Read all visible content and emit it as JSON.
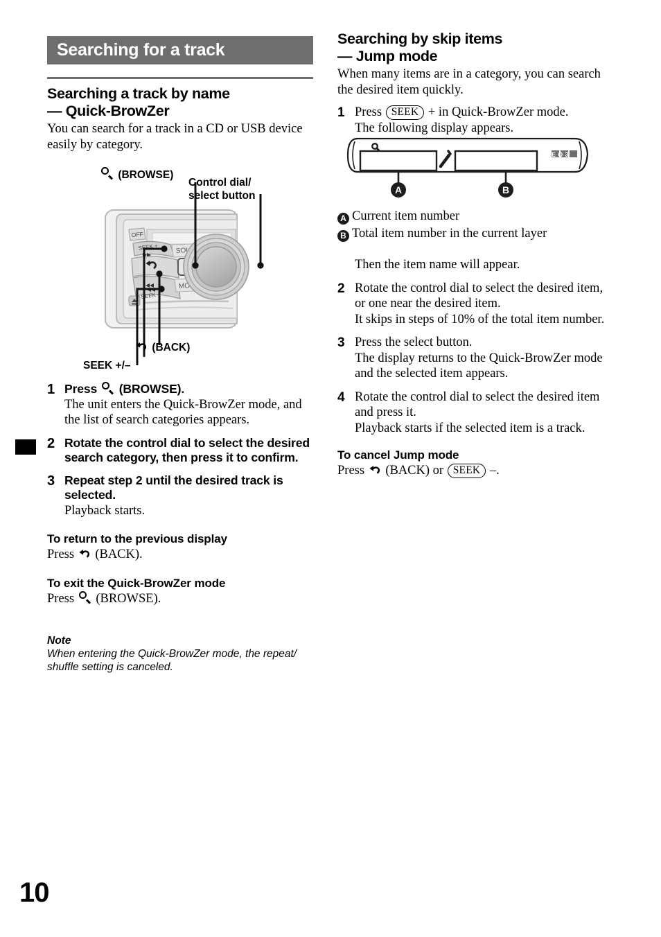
{
  "page": {
    "number": "10"
  },
  "left": {
    "section_banner": "Searching for a track",
    "subhead_line1": "Searching a track by name",
    "subhead_line2": "— Quick-BrowZer",
    "intro": "You can search for a track in a CD or USB device easily by category.",
    "figure": {
      "label_browse": "(BROWSE)",
      "label_control_dial_line1": "Control dial/",
      "label_control_dial_line2": "select button",
      "label_back": "(BACK)",
      "label_seek": "SEEK +/–",
      "unit_buttons": {
        "off": "OFF",
        "seek_plus": "SEEK +",
        "seek_minus": "SEEK –",
        "source": "SOURCE",
        "mode": "MODE"
      }
    },
    "steps": [
      {
        "num": "1",
        "title_pre": "Press",
        "title_icon": "magnifier-icon",
        "title_post": "(BROWSE).",
        "desc": "The unit enters the Quick-BrowZer mode, and the list of search categories appears."
      },
      {
        "num": "2",
        "title": "Rotate the control dial to select the desired search category, then press it to confirm.",
        "desc": ""
      },
      {
        "num": "3",
        "title": "Repeat step 2 until the desired track is selected.",
        "desc": "Playback starts."
      }
    ],
    "return_head": "To return to the previous display",
    "return_pre": "Press",
    "return_post": "(BACK).",
    "exit_head": "To exit the Quick-BrowZer mode",
    "exit_pre": "Press",
    "exit_post": "(BROWSE).",
    "note_head": "Note",
    "note_body": "When entering the Quick-BrowZer mode, the repeat/ shuffle setting is canceled."
  },
  "right": {
    "subhead_line1": "Searching by skip items",
    "subhead_line2": "— Jump mode",
    "intro": "When many items are in a category, you can search the desired item quickly.",
    "step1": {
      "num": "1",
      "pre": "Press",
      "seek_label": "SEEK",
      "post": "+ in Quick-BrowZer mode.",
      "desc": "The following display appears."
    },
    "figure": {
      "badge_a": "A",
      "badge_b": "B",
      "eq_label": "EQ3",
      "mag_icon": "magnifier-icon"
    },
    "legend": [
      {
        "badge": "A",
        "text": "Current item number"
      },
      {
        "badge": "B",
        "text": "Total item number in the current layer"
      }
    ],
    "then_text": "Then the item name will appear.",
    "steps": [
      {
        "num": "2",
        "title": "Rotate the control dial to select the desired item, or one near the desired item.",
        "desc": "It skips in steps of 10% of the total item number."
      },
      {
        "num": "3",
        "title": "Press the select button.",
        "desc": "The display returns to the Quick-BrowZer mode and the selected item appears."
      },
      {
        "num": "4",
        "title": "Rotate the control dial to select the desired item and press it.",
        "desc": "Playback starts if the selected item is a track."
      }
    ],
    "cancel_head": "To cancel Jump mode",
    "cancel_pre": "Press",
    "cancel_mid": "(BACK) or",
    "cancel_seek": "SEEK",
    "cancel_post": "–."
  },
  "colors": {
    "banner_gray": "#6e6e6e",
    "text_black": "#000000"
  }
}
